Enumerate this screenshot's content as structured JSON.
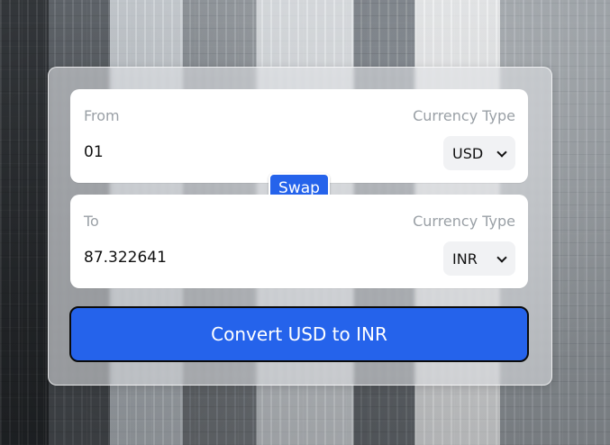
{
  "colors": {
    "accent": "#2563eb",
    "card": "#ffffff",
    "muted_text": "#9aa0a6",
    "text": "#111111"
  },
  "from": {
    "label": "From",
    "currency_type_label": "Currency Type",
    "amount": "01",
    "currency": "USD"
  },
  "swap": {
    "label": "Swap"
  },
  "to": {
    "label": "To",
    "currency_type_label": "Currency Type",
    "amount": "87.322641",
    "currency": "INR"
  },
  "action": {
    "convert_label": "Convert USD to INR"
  },
  "icons": {
    "dropdown": "chevron-down-icon"
  }
}
